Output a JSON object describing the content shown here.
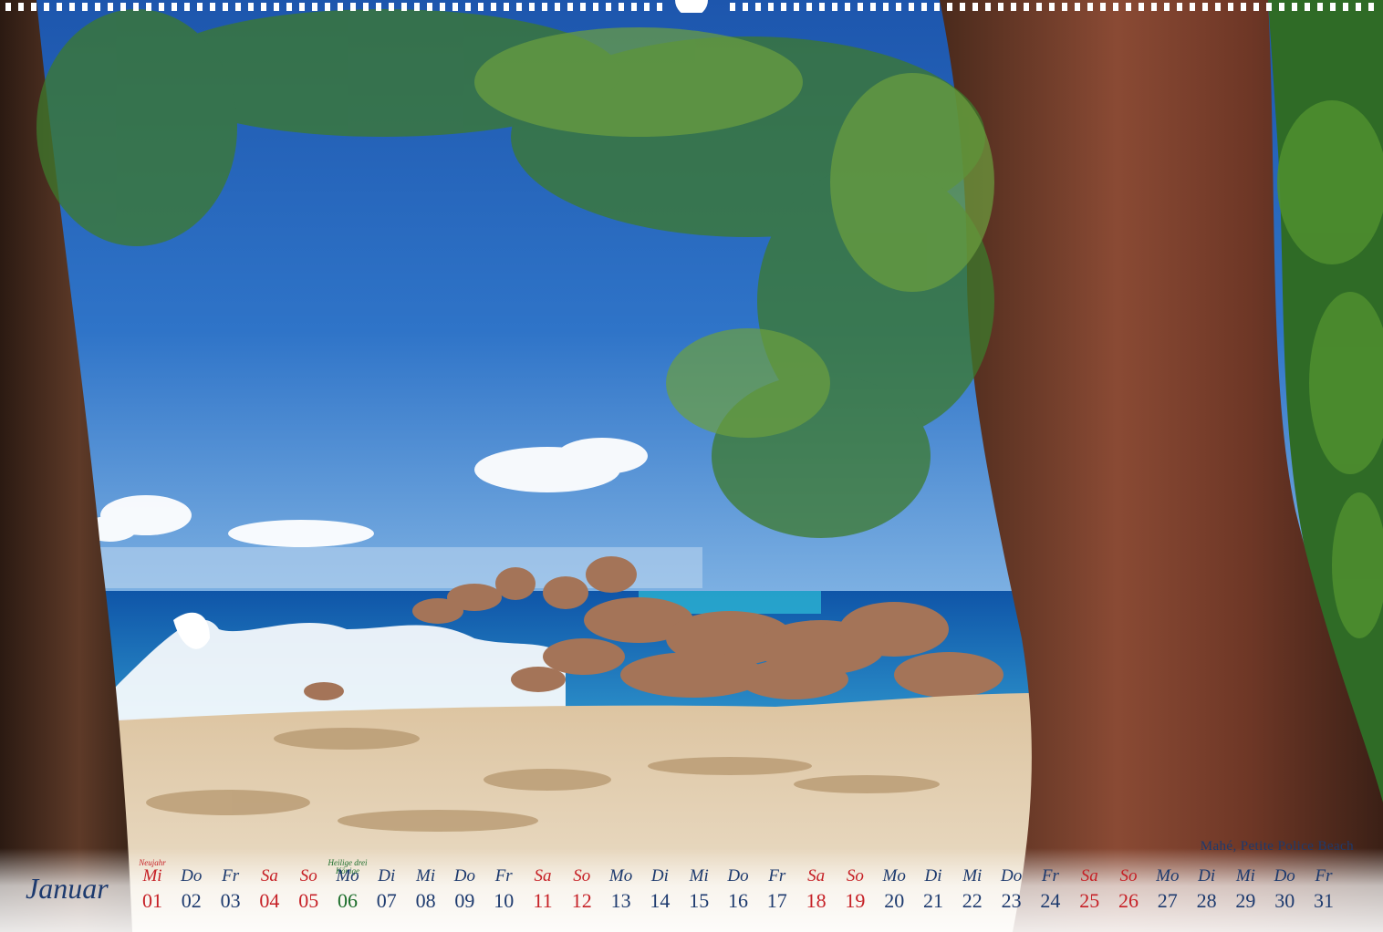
{
  "caption": "Mahé, Petite Police Beach",
  "month": "Januar",
  "days": [
    {
      "wd": "Mi",
      "num": "01",
      "holiday": "Neujahr",
      "red": true
    },
    {
      "wd": "Do",
      "num": "02"
    },
    {
      "wd": "Fr",
      "num": "03"
    },
    {
      "wd": "Sa",
      "num": "04",
      "red": true
    },
    {
      "wd": "So",
      "num": "05",
      "red": true
    },
    {
      "wd": "Mo",
      "num": "06",
      "holiday": "Heilige drei Könige",
      "green": true
    },
    {
      "wd": "Di",
      "num": "07"
    },
    {
      "wd": "Mi",
      "num": "08"
    },
    {
      "wd": "Do",
      "num": "09"
    },
    {
      "wd": "Fr",
      "num": "10"
    },
    {
      "wd": "Sa",
      "num": "11",
      "red": true
    },
    {
      "wd": "So",
      "num": "12",
      "red": true
    },
    {
      "wd": "Mo",
      "num": "13"
    },
    {
      "wd": "Di",
      "num": "14"
    },
    {
      "wd": "Mi",
      "num": "15"
    },
    {
      "wd": "Do",
      "num": "16"
    },
    {
      "wd": "Fr",
      "num": "17"
    },
    {
      "wd": "Sa",
      "num": "18",
      "red": true
    },
    {
      "wd": "So",
      "num": "19",
      "red": true
    },
    {
      "wd": "Mo",
      "num": "20"
    },
    {
      "wd": "Di",
      "num": "21"
    },
    {
      "wd": "Mi",
      "num": "22"
    },
    {
      "wd": "Do",
      "num": "23"
    },
    {
      "wd": "Fr",
      "num": "24"
    },
    {
      "wd": "Sa",
      "num": "25",
      "red": true
    },
    {
      "wd": "So",
      "num": "26",
      "red": true
    },
    {
      "wd": "Mo",
      "num": "27"
    },
    {
      "wd": "Di",
      "num": "28"
    },
    {
      "wd": "Mi",
      "num": "29"
    },
    {
      "wd": "Do",
      "num": "30"
    },
    {
      "wd": "Fr",
      "num": "31"
    }
  ],
  "colors": {
    "text": "#1d3a6e",
    "weekend": "#c62026",
    "holiday_green": "#1b6d2a"
  }
}
